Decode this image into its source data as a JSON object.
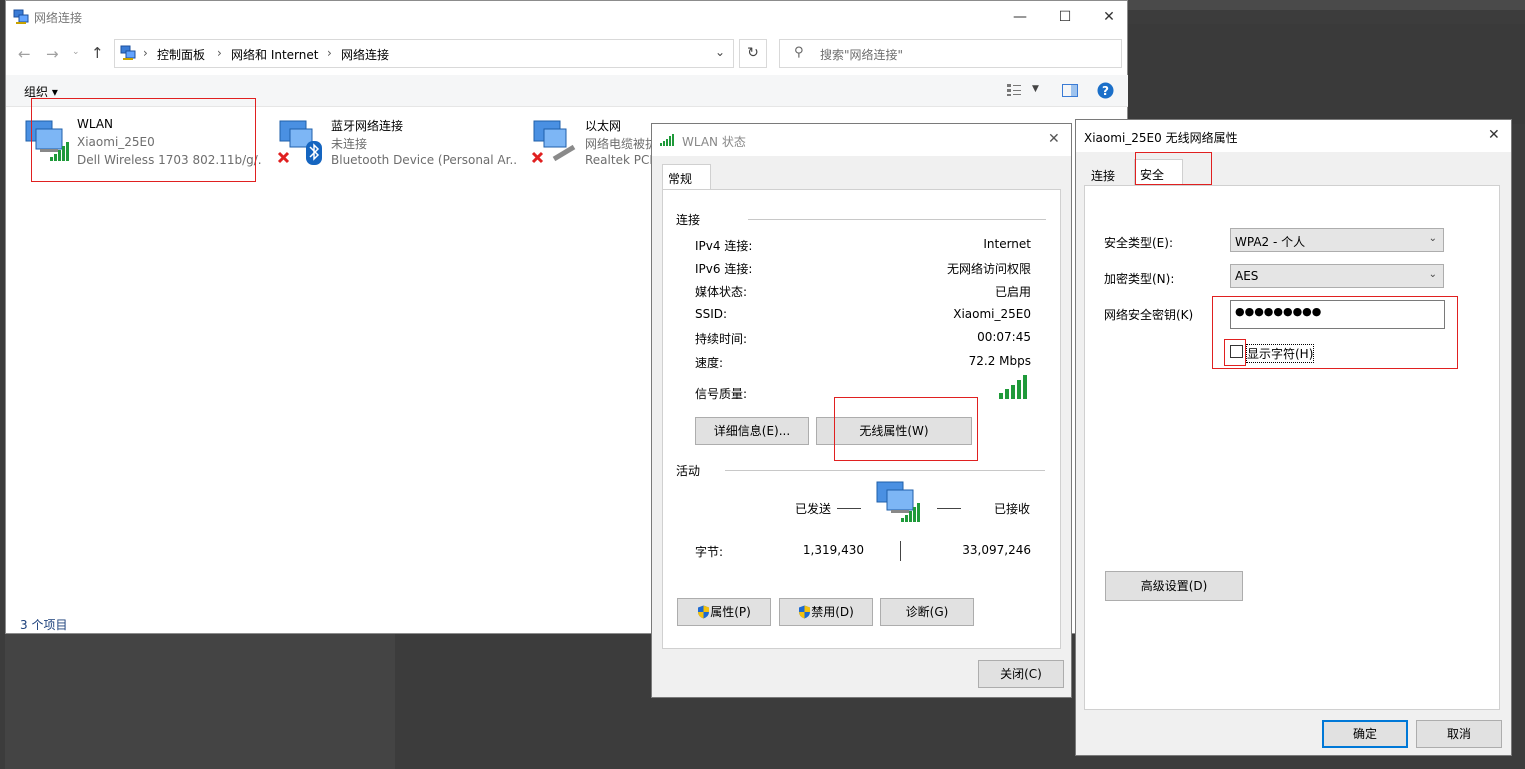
{
  "explorer": {
    "title": "网络连接",
    "breadcrumb": [
      "控制面板",
      "网络和 Internet",
      "网络连接"
    ],
    "search_placeholder": "搜索\"网络连接\"",
    "organize_label": "组织",
    "status_text": "3 个项目",
    "items": [
      {
        "name": "WLAN",
        "status": "Xiaomi_25E0",
        "device": "Dell Wireless 1703 802.11b/g/..."
      },
      {
        "name": "蓝牙网络连接",
        "status": "未连接",
        "device": "Bluetooth Device (Personal Ar..."
      },
      {
        "name": "以太网",
        "status": "网络电缆被拔出",
        "device": "Realtek PCIe"
      }
    ]
  },
  "wlan_status": {
    "title": "WLAN 状态",
    "tab": "常规",
    "section_connection": "连接",
    "rows": [
      {
        "label": "IPv4 连接:",
        "value": "Internet"
      },
      {
        "label": "IPv6 连接:",
        "value": "无网络访问权限"
      },
      {
        "label": "媒体状态:",
        "value": "已启用"
      },
      {
        "label": "SSID:",
        "value": "Xiaomi_25E0"
      },
      {
        "label": "持续时间:",
        "value": "00:07:45"
      },
      {
        "label": "速度:",
        "value": "72.2 Mbps"
      }
    ],
    "signal_label": "信号质量:",
    "details_button": "详细信息(E)...",
    "wireless_props_button": "无线属性(W)",
    "section_activity": "活动",
    "sent_label": "已发送",
    "received_label": "已接收",
    "bytes_label": "字节:",
    "bytes_sent": "1,319,430",
    "bytes_received": "33,097,246",
    "properties_button": "属性(P)",
    "disable_button": "禁用(D)",
    "diagnose_button": "诊断(G)",
    "close_button": "关闭(C)"
  },
  "wireless_props": {
    "title": "Xiaomi_25E0 无线网络属性",
    "tabs": [
      "连接",
      "安全"
    ],
    "security_type_label": "安全类型(E):",
    "security_type_value": "WPA2 - 个人",
    "encryption_type_label": "加密类型(N):",
    "encryption_type_value": "AES",
    "key_label": "网络安全密钥(K)",
    "key_value": "●●●●●●●●●",
    "show_chars_label": "显示字符(H)",
    "advanced_button": "高级设置(D)",
    "ok_button": "确定",
    "cancel_button": "取消"
  },
  "colors": {
    "accent": "#0078d7",
    "highlight_box": "#e02020",
    "help": "#1a6fc9"
  }
}
